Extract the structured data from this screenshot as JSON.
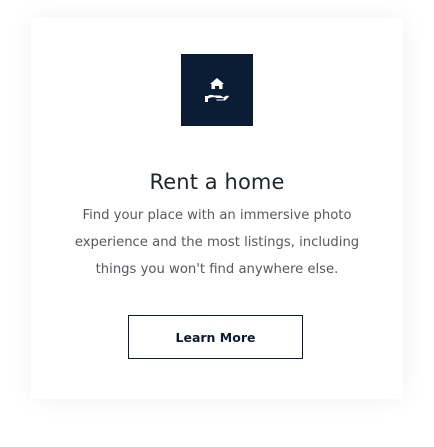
{
  "card": {
    "icon": "home-rent-icon",
    "title": "Rent a home",
    "description_lines": [
      "Find your place with an immersive photo",
      "experience and the most listings, including",
      "things you won't find anywhere else."
    ],
    "button_label": "Learn More"
  },
  "colors": {
    "accent": "#0b1d35",
    "title_text": "#1f2430",
    "body_text": "#56595f",
    "background": "#ffffff"
  }
}
